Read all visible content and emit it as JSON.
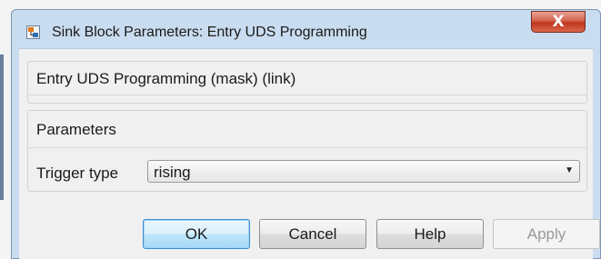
{
  "window": {
    "title": "Sink Block Parameters: Entry UDS Programming",
    "close_glyph": "X",
    "app_icon": "simulink-block-icon"
  },
  "description": {
    "title": "Entry UDS Programming (mask) (link)"
  },
  "parameters": {
    "group_title": "Parameters",
    "trigger_type": {
      "label": "Trigger type",
      "value": "rising"
    }
  },
  "buttons": {
    "ok": "OK",
    "cancel": "Cancel",
    "help": "Help",
    "apply": "Apply"
  },
  "colors": {
    "frame": "#c9dcf0",
    "close": "#c0371e",
    "ok_highlight": "#3c8fd4"
  }
}
